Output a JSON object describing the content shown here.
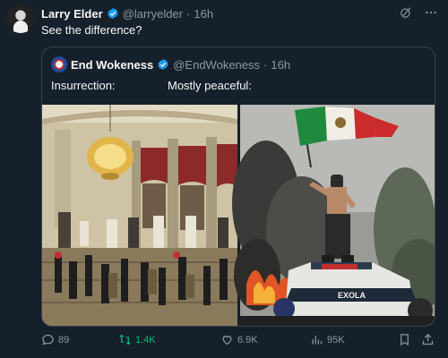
{
  "tweet": {
    "author_name": "Larry Elder",
    "handle": "@larryelder",
    "separator": "·",
    "time": "16h",
    "text": "See the difference?"
  },
  "quote": {
    "author_name": "End Wokeness",
    "handle": "@EndWokeness",
    "separator": "·",
    "time": "16h",
    "caption_left": "Insurrection:",
    "caption_right": "Mostly peaceful:",
    "police_car_text": "EXOLA"
  },
  "actions": {
    "replies": "89",
    "reposts": "1.4K",
    "likes": "6.9K",
    "views": "95K"
  },
  "colors": {
    "background": "#15202b",
    "verified": "#1d9bf0",
    "repost": "#00ba7c",
    "muted": "#8b98a5"
  }
}
